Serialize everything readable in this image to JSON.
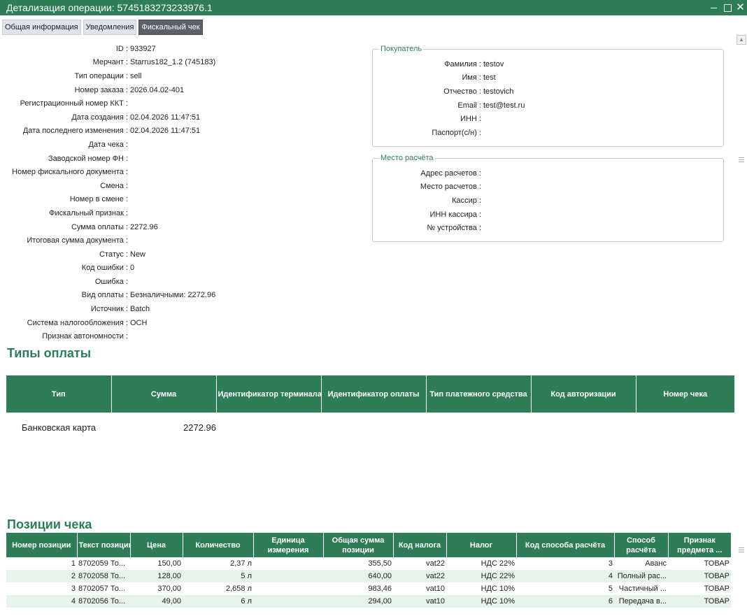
{
  "window": {
    "title": "Детализация операции: 5745183273233976.1"
  },
  "tabs": [
    {
      "label": "Общая информация",
      "active": false
    },
    {
      "label": "Уведомления",
      "active": false
    },
    {
      "label": "Фискальный чек",
      "active": true
    }
  ],
  "info": [
    {
      "label": "ID :",
      "value": "933927"
    },
    {
      "label": "Мерчант :",
      "value": "Starrus182_1.2 (745183)"
    },
    {
      "label": "Тип операции :",
      "value": "sell"
    },
    {
      "label": "Номер заказа :",
      "value": "2026.04.02-401"
    },
    {
      "label": "Регистрационный номер ККТ :",
      "value": ""
    },
    {
      "label": "Дата создания :",
      "value": "02.04.2026 11:47:51"
    },
    {
      "label": "Дата последнего изменения :",
      "value": "02.04.2026 11:47:51"
    },
    {
      "label": "Дата чека :",
      "value": ""
    },
    {
      "label": "Заводской номер ФН :",
      "value": ""
    },
    {
      "label": "Номер фискального документа :",
      "value": ""
    },
    {
      "label": "Смена :",
      "value": ""
    },
    {
      "label": "Номер в смене :",
      "value": ""
    },
    {
      "label": "Фискальный признак :",
      "value": ""
    },
    {
      "label": "Сумма оплаты :",
      "value": "2272.96"
    },
    {
      "label": "Итоговая сумма документа :",
      "value": ""
    },
    {
      "label": "Статус :",
      "value": "New"
    },
    {
      "label": "Код ошибки :",
      "value": "0"
    },
    {
      "label": "Ошибка :",
      "value": ""
    },
    {
      "label": "Вид оплаты :",
      "value": "Безналичными: 2272.96"
    },
    {
      "label": "Источник :",
      "value": "Batch"
    },
    {
      "label": "Система налогообложения :",
      "value": "ОСН"
    },
    {
      "label": "Признак автономности :",
      "value": ""
    }
  ],
  "buyer": {
    "legend": "Покупатель",
    "rows": [
      {
        "label": "Фамилия :",
        "value": "testov"
      },
      {
        "label": "Имя :",
        "value": "test"
      },
      {
        "label": "Отчество :",
        "value": "testovich"
      },
      {
        "label": "Email :",
        "value": "test@test.ru"
      },
      {
        "label": "ИНН :",
        "value": ""
      },
      {
        "label": "Паспорт(с/н) :",
        "value": ""
      }
    ]
  },
  "place": {
    "legend": "Место расчёта",
    "rows": [
      {
        "label": "Адрес расчетов :",
        "value": ""
      },
      {
        "label": "Место расчетов :",
        "value": ""
      },
      {
        "label": "Кассир :",
        "value": ""
      },
      {
        "label": "ИНН кассира :",
        "value": ""
      },
      {
        "label": "№ устройства :",
        "value": ""
      }
    ]
  },
  "payments": {
    "title": "Типы оплаты",
    "columns": [
      "Тип",
      "Сумма",
      "Идентификатор терминала",
      "Идентификатор оплаты",
      "Тип платежного средства",
      "Код авторизации",
      "Номер чека"
    ],
    "rows": [
      [
        "Банковская карта",
        "2272.96",
        "",
        "",
        "",
        "",
        ""
      ]
    ]
  },
  "positions": {
    "title": "Позиции чека",
    "columns": [
      "Номер позиции",
      "Текст позиции",
      "Цена",
      "Количество",
      "Единица измерения",
      "Общая сумма позиции",
      "Код налога",
      "Налог",
      "Код способа расчёта",
      "Способ расчёта",
      "Признак предмета ..."
    ],
    "rows": [
      [
        "1",
        "8702059 То...",
        "150,00",
        "2,37 л",
        "",
        "355,50",
        "vat22",
        "НДС 22%",
        "3",
        "Аванс",
        "ТОВАР"
      ],
      [
        "2",
        "8702058 То...",
        "128,00",
        "5 л",
        "",
        "640,00",
        "vat22",
        "НДС 22%",
        "4",
        "Полный рас...",
        "ТОВАР"
      ],
      [
        "3",
        "8702057 То...",
        "370,00",
        "2,658 л",
        "",
        "983,46",
        "vat10",
        "НДС 10%",
        "5",
        "Частичный ...",
        "ТОВАР"
      ],
      [
        "4",
        "8702056 То...",
        "49,00",
        "6 л",
        "",
        "294,00",
        "vat10",
        "НДС 10%",
        "6",
        "Передача в...",
        "ТОВАР"
      ]
    ]
  },
  "colors": {
    "accent": "#2f7d58",
    "row_alt": "#e8f3ec"
  }
}
